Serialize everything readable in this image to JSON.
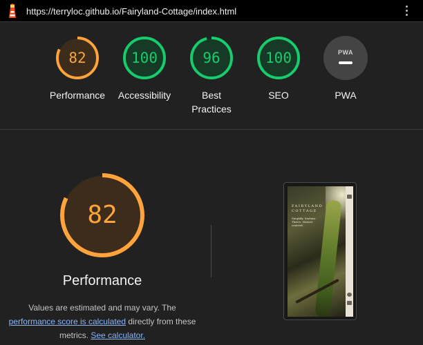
{
  "topbar": {
    "url": "https://terryloc.github.io/Fairyland-Cottage/index.html",
    "logo_icon": "lighthouse-icon",
    "menu_icon": "kebab-menu-icon"
  },
  "colors": {
    "average": "#ffa43c",
    "pass": "#17cc6c",
    "pwa_gray": "#444444",
    "background": "#212121"
  },
  "gauges": [
    {
      "label": "Performance",
      "score": "82",
      "value": 82,
      "status": "average"
    },
    {
      "label": "Accessibility",
      "score": "100",
      "value": 100,
      "status": "pass"
    },
    {
      "label": "Best Practices",
      "score": "96",
      "value": 96,
      "status": "pass"
    },
    {
      "label": "SEO",
      "score": "100",
      "value": 100,
      "status": "pass"
    },
    {
      "label": "PWA",
      "badge_text": "PWA",
      "badge_icon": "pwa-badge-icon"
    }
  ],
  "performance": {
    "score": "82",
    "value": 82,
    "title": "Performance",
    "note_prefix": "Values are estimated and may vary. The",
    "score_link": "performance score is calculated",
    "note_middle": "directly from these metrics.",
    "calc_link": "See calculator."
  },
  "screenshot": {
    "brand_line1": "FAIRYLAND",
    "brand_line2": "COTTAGE",
    "tagline": "Simplify. Sustain. Thrive. Nature-centred.",
    "alt": "final-screenshot"
  }
}
